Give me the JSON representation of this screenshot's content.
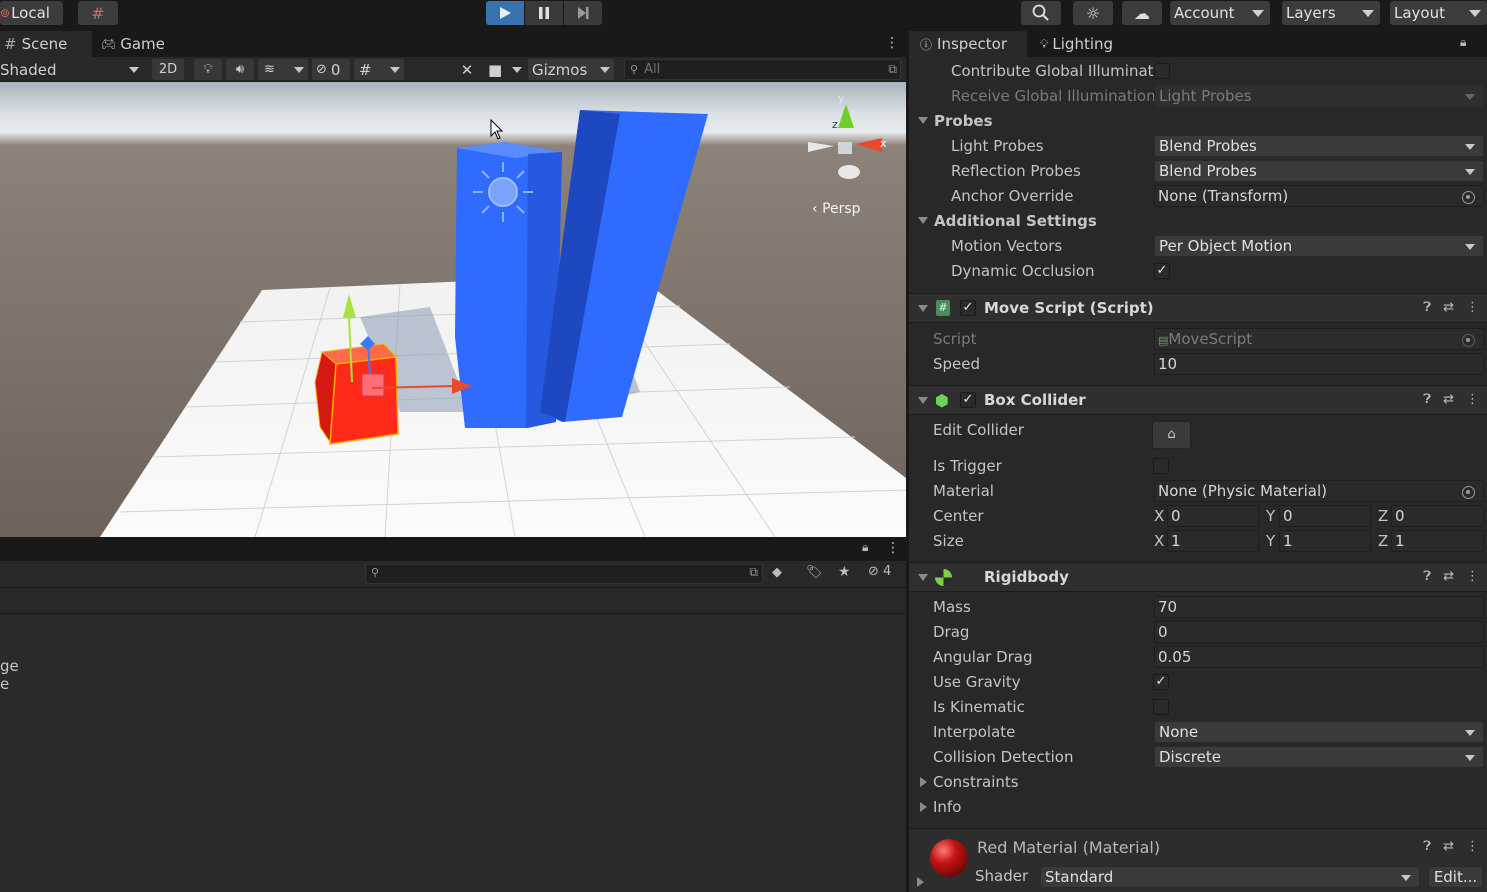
{
  "toolbar": {
    "local_label": "Local",
    "account_label": "Account",
    "layers_label": "Layers",
    "layout_label": "Layout"
  },
  "scene": {
    "tab_scene": "Scene",
    "tab_game": "Game",
    "shading_mode": "Shaded",
    "mode_2d": "2D",
    "hidden_count": "0",
    "gizmos_label": "Gizmos",
    "search_placeholder": "All",
    "projection_label": "Persp",
    "axis_x": "x",
    "axis_y": "y",
    "axis_z": "z"
  },
  "bottom": {
    "hidden_count": "4",
    "text_fragment_1": "ge",
    "text_fragment_2": "e"
  },
  "inspector": {
    "tab_inspector": "Inspector",
    "tab_lighting": "Lighting",
    "mesh_renderer": {
      "contribute_gi_label": "Contribute Global Illuminatic",
      "receive_gi_label": "Receive Global Illumination",
      "receive_gi_value": "Light Probes",
      "probes_header": "Probes",
      "light_probes_label": "Light Probes",
      "light_probes_value": "Blend Probes",
      "reflection_probes_label": "Reflection Probes",
      "reflection_probes_value": "Blend Probes",
      "anchor_override_label": "Anchor Override",
      "anchor_override_value": "None (Transform)",
      "additional_header": "Additional Settings",
      "motion_vectors_label": "Motion Vectors",
      "motion_vectors_value": "Per Object Motion",
      "dynamic_occlusion_label": "Dynamic Occlusion"
    },
    "move_script": {
      "title": "Move Script (Script)",
      "script_label": "Script",
      "script_value": "MoveScript",
      "speed_label": "Speed",
      "speed_value": "10"
    },
    "box_collider": {
      "title": "Box Collider",
      "edit_collider_label": "Edit Collider",
      "is_trigger_label": "Is Trigger",
      "material_label": "Material",
      "material_value": "None (Physic Material)",
      "center_label": "Center",
      "center": {
        "x": "0",
        "y": "0",
        "z": "0"
      },
      "size_label": "Size",
      "size": {
        "x": "1",
        "y": "1",
        "z": "1"
      },
      "axis_x": "X",
      "axis_y": "Y",
      "axis_z": "Z"
    },
    "rigidbody": {
      "title": "Rigidbody",
      "mass_label": "Mass",
      "mass_value": "70",
      "drag_label": "Drag",
      "drag_value": "0",
      "angular_drag_label": "Angular Drag",
      "angular_drag_value": "0.05",
      "use_gravity_label": "Use Gravity",
      "is_kinematic_label": "Is Kinematic",
      "interpolate_label": "Interpolate",
      "interpolate_value": "None",
      "collision_detection_label": "Collision Detection",
      "collision_detection_value": "Discrete",
      "constraints_label": "Constraints",
      "info_label": "Info"
    },
    "material": {
      "title": "Red Material (Material)",
      "shader_label": "Shader",
      "shader_value": "Standard",
      "edit_label": "Edit..."
    }
  },
  "colors": {
    "accent_play": "#3a72b0",
    "cube_red": "#ff2a1a",
    "pillar_blue": "#2f6bff",
    "panel_bg": "#282828"
  }
}
